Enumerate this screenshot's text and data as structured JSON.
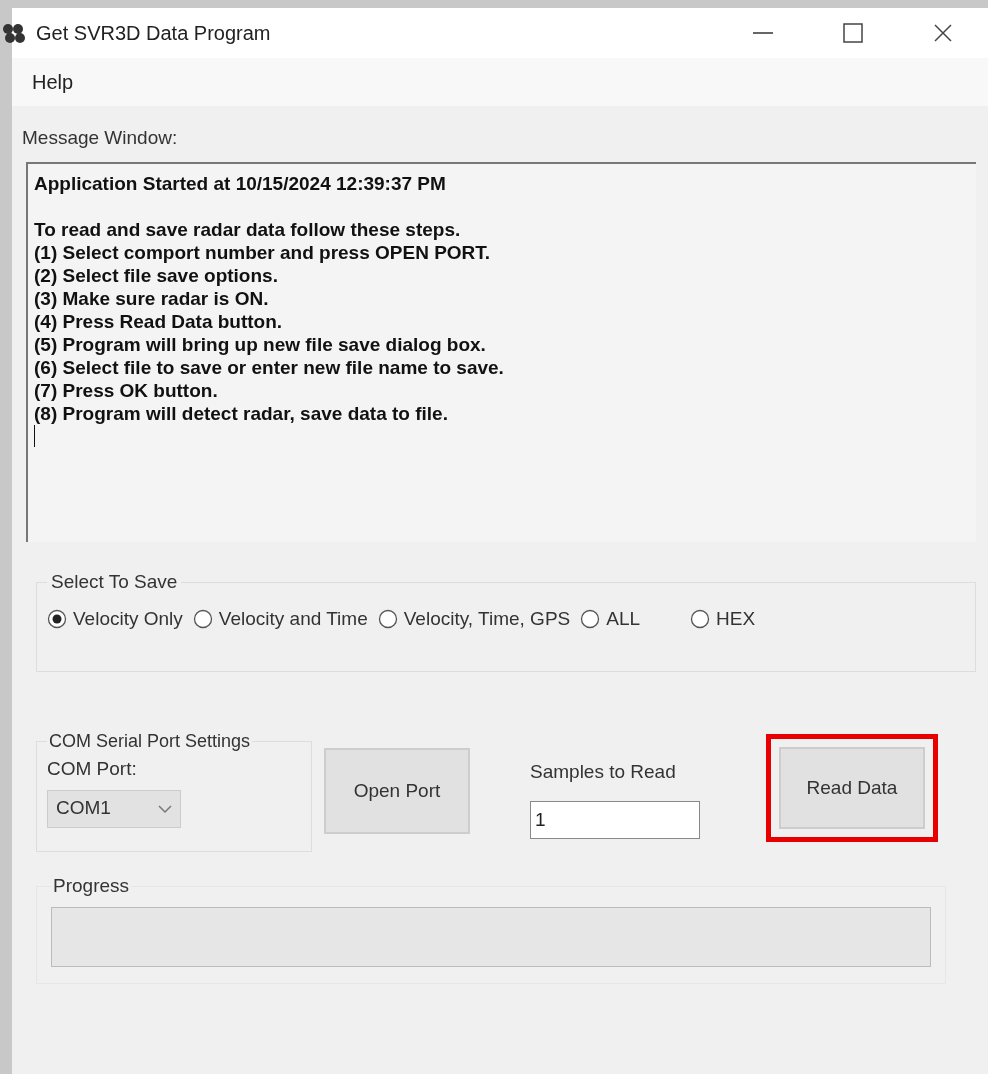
{
  "window": {
    "title": "Get SVR3D Data Program"
  },
  "menu": [
    {
      "label": "Help"
    }
  ],
  "message_window": {
    "label": "Message Window:",
    "header": "Application Started at 10/15/2024 12:39:37 PM",
    "lines": [
      "To read and save radar data follow these steps.",
      "(1) Select comport number and press OPEN PORT.",
      "(2) Select file save options.",
      "(3) Make sure radar is ON.",
      "(4) Press Read Data button.",
      "(5) Program will bring up new file save dialog box.",
      "(6) Select file to save or enter new file name to save.",
      "(7) Press OK button.",
      "(8) Program will detect radar, save data to file."
    ]
  },
  "select_to_save": {
    "title": "Select To Save",
    "options": [
      {
        "label": "Velocity Only",
        "selected": true
      },
      {
        "label": "Velocity and Time",
        "selected": false
      },
      {
        "label": "Velocity, Time, GPS",
        "selected": false
      },
      {
        "label": "ALL",
        "selected": false
      },
      {
        "label": "HEX",
        "selected": false
      }
    ]
  },
  "com_settings": {
    "title": "COM Serial Port Settings",
    "port_label": "COM Port:",
    "port_value": "COM1"
  },
  "open_port_button": {
    "label": "Open Port"
  },
  "samples": {
    "label": "Samples to Read",
    "value": "1"
  },
  "read_data_button": {
    "label": "Read Data",
    "highlighted": true
  },
  "progress": {
    "title": "Progress",
    "level": 0
  }
}
